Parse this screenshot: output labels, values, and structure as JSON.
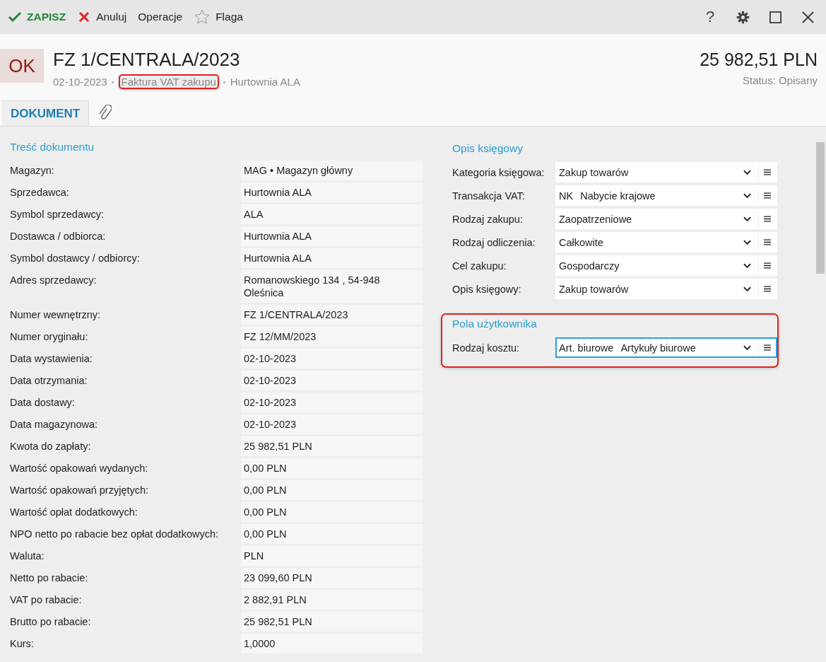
{
  "toolbar": {
    "actions": [
      {
        "kind": "save",
        "label": "ZAPISZ"
      },
      {
        "kind": "cancel",
        "label": "Anuluj"
      },
      {
        "kind": "plain",
        "label": "Operacje"
      },
      {
        "kind": "flag",
        "label": "Flaga"
      }
    ],
    "window_controls": [
      {
        "kind": "help",
        "label": "?"
      },
      {
        "kind": "settings"
      },
      {
        "kind": "maximize"
      },
      {
        "kind": "close"
      }
    ]
  },
  "header": {
    "status_badge": "OK",
    "title": "FZ 1/CENTRALA/2023",
    "separator": "•",
    "meta": [
      {
        "text": "02-10-2023",
        "highlighted": false
      },
      {
        "text": "Faktura VAT zakupu",
        "highlighted": true
      },
      {
        "text": "Hurtownia ALA",
        "highlighted": false
      }
    ],
    "amount": "25 982,51 PLN",
    "status": "Status: Opisany"
  },
  "tabs": [
    {
      "kind": "text",
      "label": "DOKUMENT",
      "selected": true
    },
    {
      "kind": "attachment",
      "selected": false
    }
  ],
  "document_content": {
    "title": "Treść dokumentu",
    "fields": [
      {
        "label": "Magazyn:",
        "value": "MAG • Magazyn główny"
      },
      {
        "label": "Sprzedawca:",
        "value": "Hurtownia ALA"
      },
      {
        "label": "Symbol sprzedawcy:",
        "value": "ALA"
      },
      {
        "label": "Dostawca / odbiorca:",
        "value": "Hurtownia ALA"
      },
      {
        "label": "Symbol dostawcy / odbiorcy:",
        "value": "Hurtownia ALA"
      },
      {
        "label": "Adres sprzedawcy:",
        "value": "Romanowskiego 134 , 54-948 Oleśnica"
      },
      {
        "label": "Numer wewnętrzny:",
        "value": "FZ 1/CENTRALA/2023"
      },
      {
        "label": "Numer oryginału:",
        "value": "FZ 12/MM/2023"
      },
      {
        "label": "Data wystawienia:",
        "value": "02-10-2023"
      },
      {
        "label": "Data otrzymania:",
        "value": "02-10-2023"
      },
      {
        "label": "Data dostawy:",
        "value": "02-10-2023"
      },
      {
        "label": "Data magazynowa:",
        "value": "02-10-2023"
      },
      {
        "label": "Kwota do zapłaty:",
        "value": "25 982,51 PLN"
      },
      {
        "label": "Wartość opakowań wydanych:",
        "value": "0,00 PLN"
      },
      {
        "label": "Wartość opakowań przyjętych:",
        "value": "0,00 PLN"
      },
      {
        "label": "Wartość opłat dodatkowych:",
        "value": "0,00 PLN"
      },
      {
        "label": "NPO netto po rabacie bez opłat dodatkowych:",
        "value": "0,00 PLN"
      },
      {
        "label": "Waluta:",
        "value": "PLN"
      },
      {
        "label": "Netto po rabacie:",
        "value": "23 099,60 PLN"
      },
      {
        "label": "VAT po rabacie:",
        "value": "2 882,91 PLN"
      },
      {
        "label": "Brutto po rabacie:",
        "value": "25 982,51 PLN"
      },
      {
        "label": "Kurs:",
        "value": "1,0000"
      }
    ]
  },
  "accounting": {
    "title": "Opis księgowy",
    "highlighted": false,
    "fields": [
      {
        "label": "Kategoria księgowa:",
        "value": "Zakup towarów",
        "focused": false
      },
      {
        "label": "Transakcja VAT:",
        "code": "NK",
        "value": "Nabycie krajowe",
        "focused": false
      },
      {
        "label": "Rodzaj zakupu:",
        "value": "Zaopatrzeniowe",
        "focused": false
      },
      {
        "label": "Rodzaj odliczenia:",
        "value": "Całkowite",
        "focused": false
      },
      {
        "label": "Cel zakupu:",
        "value": "Gospodarczy",
        "focused": false
      },
      {
        "label": "Opis księgowy:",
        "value": "Zakup towarów",
        "focused": false
      }
    ]
  },
  "user_fields": {
    "title": "Pola użytkownika",
    "highlighted": true,
    "fields": [
      {
        "label": "Rodzaj kosztu:",
        "code": "Art. biurowe",
        "value": "Artykuły biurowe",
        "focused": true
      }
    ]
  }
}
